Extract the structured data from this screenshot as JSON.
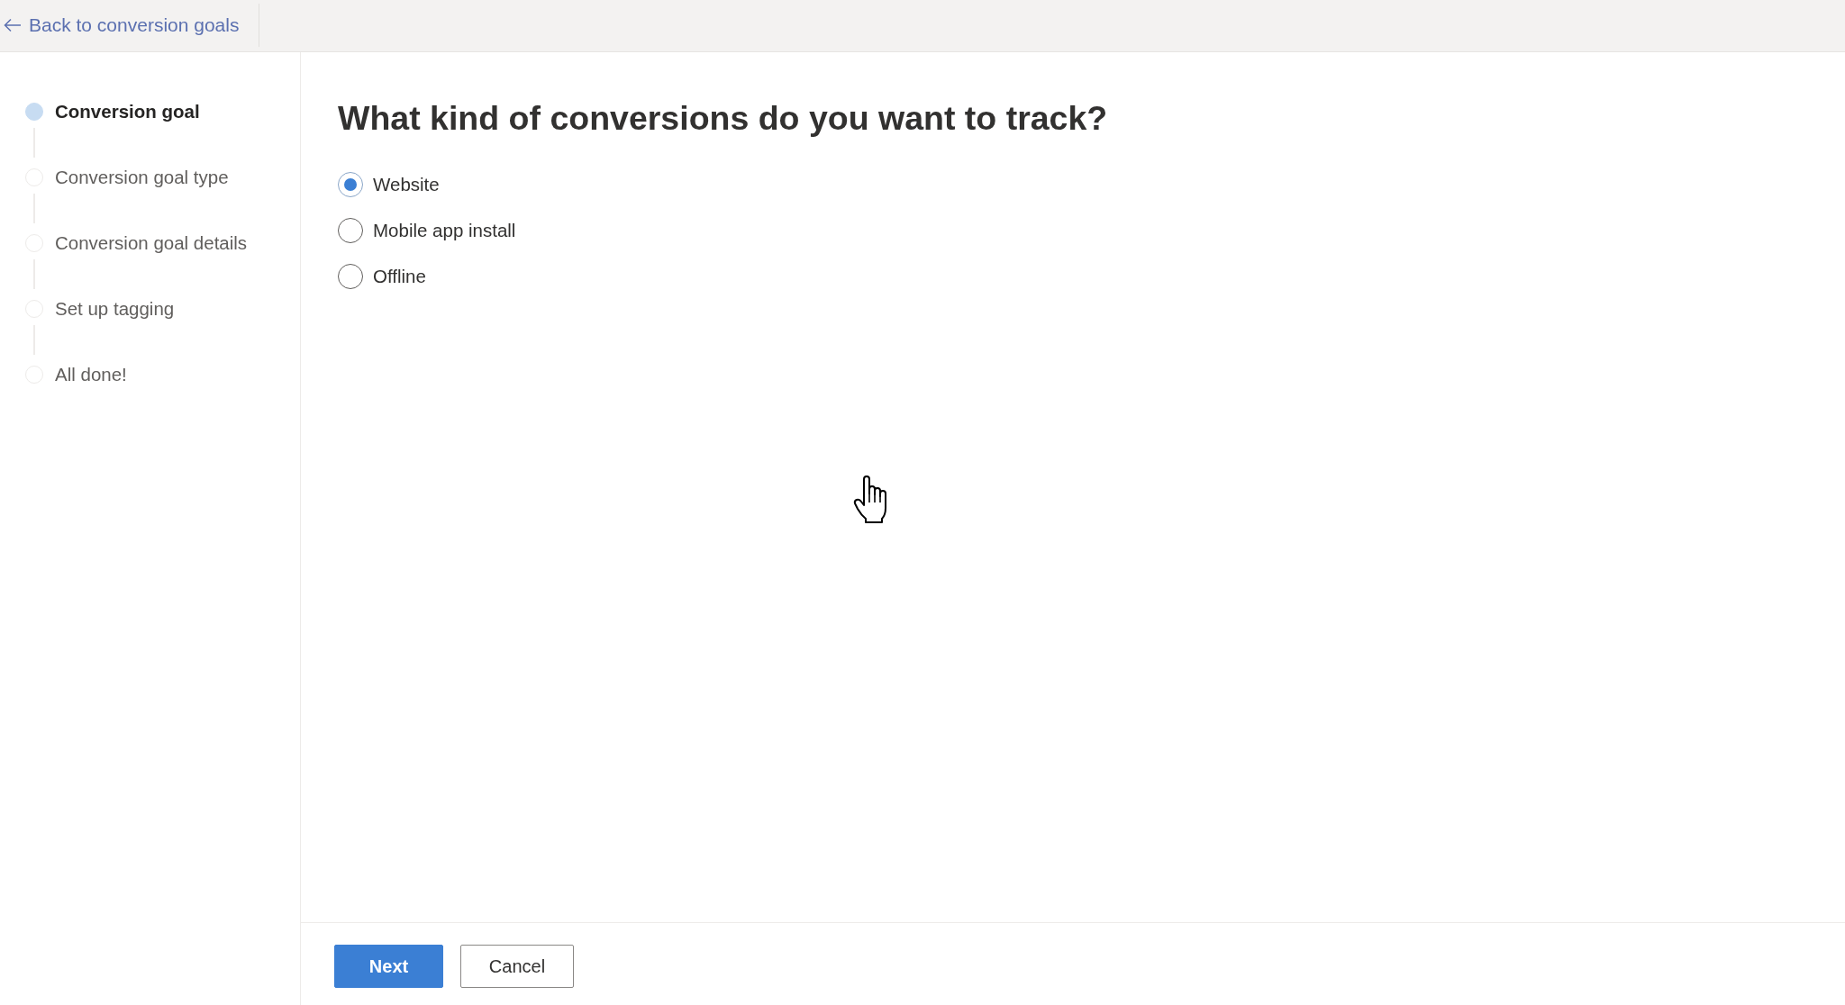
{
  "back_link": {
    "label": "Back to conversion goals"
  },
  "steps": [
    {
      "label": "Conversion goal",
      "selected": true
    },
    {
      "label": "Conversion goal type",
      "selected": false
    },
    {
      "label": "Conversion goal details",
      "selected": false
    },
    {
      "label": "Set up tagging",
      "selected": false
    },
    {
      "label": "All done!",
      "selected": false
    }
  ],
  "question": "What kind of conversions do you want to track?",
  "options": [
    {
      "label": "Website",
      "selected": true
    },
    {
      "label": "Mobile app install",
      "selected": false
    },
    {
      "label": "Offline",
      "selected": false
    }
  ],
  "buttons": [
    {
      "label": "Next",
      "kind": "primary"
    },
    {
      "label": "Cancel",
      "kind": "secondary"
    }
  ]
}
